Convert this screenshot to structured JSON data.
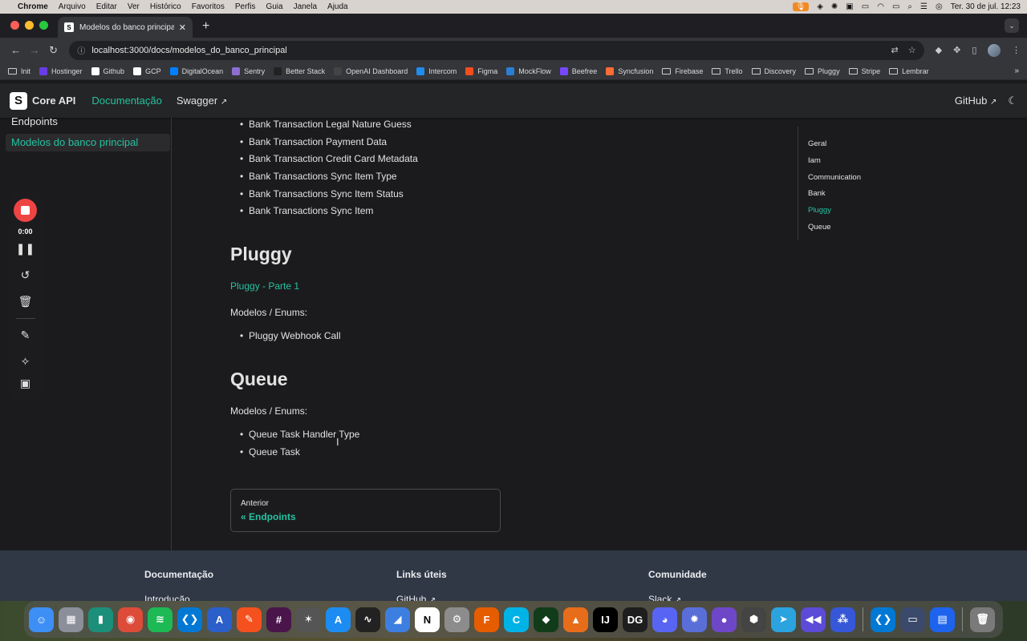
{
  "menubar": {
    "apple": "",
    "items": [
      "Chrome",
      "Arquivo",
      "Editar",
      "Ver",
      "Histórico",
      "Favoritos",
      "Perfis",
      "Guia",
      "Janela",
      "Ajuda"
    ],
    "datetime": "Ter. 30 de jul.  12:23"
  },
  "browser": {
    "tab_title": "Modelos do banco principal |",
    "url": "localhost:3000/docs/modelos_do_banco_principal",
    "bookmarks": [
      {
        "label": "Init",
        "kind": "folder"
      },
      {
        "label": "Hostinger",
        "color": "#673de6"
      },
      {
        "label": "Github",
        "color": "#ffffff"
      },
      {
        "label": "GCP",
        "color": "#ffffff"
      },
      {
        "label": "DigitalOcean",
        "color": "#0080ff"
      },
      {
        "label": "Sentry",
        "color": "#8d6fd1"
      },
      {
        "label": "Better Stack",
        "color": "#222222"
      },
      {
        "label": "OpenAI Dashboard",
        "color": "#444444"
      },
      {
        "label": "Intercom",
        "color": "#1f8ded"
      },
      {
        "label": "Figma",
        "color": "#f24e1e"
      },
      {
        "label": "MockFlow",
        "color": "#2a7fd4"
      },
      {
        "label": "Beefree",
        "color": "#7747ff"
      },
      {
        "label": "Syncfusion",
        "color": "#ff6c37"
      },
      {
        "label": "Firebase",
        "kind": "folder"
      },
      {
        "label": "Trello",
        "kind": "folder"
      },
      {
        "label": "Discovery",
        "kind": "folder"
      },
      {
        "label": "Pluggy",
        "kind": "folder"
      },
      {
        "label": "Stripe",
        "kind": "folder"
      },
      {
        "label": "Lembrar",
        "kind": "folder"
      }
    ]
  },
  "docnav": {
    "brand": "Core API",
    "links": [
      "Documentação",
      "Swagger"
    ],
    "github": "GitHub"
  },
  "sidebar": {
    "items": [
      {
        "label": "Endpoints",
        "active": false
      },
      {
        "label": "Modelos do banco principal",
        "active": true
      }
    ]
  },
  "recorder": {
    "timer": "0:00"
  },
  "content": {
    "bank_items": [
      "Bank Transaction Legal Nature Guess",
      "Bank Transaction Payment Data",
      "Bank Transaction Credit Card Metadata",
      "Bank Transactions Sync Item Type",
      "Bank Transactions Sync Item Status",
      "Bank Transactions Sync Item"
    ],
    "pluggy_heading": "Pluggy",
    "pluggy_link": "Pluggy - Parte 1",
    "pluggy_models_label": "Modelos / Enums:",
    "pluggy_items": [
      "Pluggy Webhook Call"
    ],
    "queue_heading": "Queue",
    "queue_models_label": "Modelos / Enums:",
    "queue_items": [
      "Queue Task Handler Type",
      "Queue Task"
    ],
    "pager_sub": "Anterior",
    "pager_label": "« Endpoints"
  },
  "toc": {
    "items": [
      "Geral",
      "Iam",
      "Communication",
      "Bank",
      "Pluggy",
      "Queue"
    ],
    "active": "Pluggy"
  },
  "footer": {
    "columns": [
      {
        "title": "Documentação",
        "link": "Introdução"
      },
      {
        "title": "Links úteis",
        "link": "GitHub"
      },
      {
        "title": "Comunidade",
        "link": "Slack"
      }
    ]
  },
  "dock": {
    "apps": [
      {
        "name": "finder",
        "color": "#3d8ef5",
        "glyph": "☺"
      },
      {
        "name": "launchpad",
        "color": "#8a8f99",
        "glyph": "▦"
      },
      {
        "name": "app-3",
        "color": "#1b8f7a",
        "glyph": "▮"
      },
      {
        "name": "chrome",
        "color": "#dd4b39",
        "glyph": "◉"
      },
      {
        "name": "spotify",
        "color": "#1db954",
        "glyph": "≋"
      },
      {
        "name": "vscode",
        "color": "#0078d4",
        "glyph": "❮❯"
      },
      {
        "name": "app-7",
        "color": "#2b5fc9",
        "glyph": "A"
      },
      {
        "name": "app-8",
        "color": "#f4511e",
        "glyph": "✎"
      },
      {
        "name": "slack",
        "color": "#4a154b",
        "glyph": "#"
      },
      {
        "name": "app-10",
        "color": "#555555",
        "glyph": "✶"
      },
      {
        "name": "app-store",
        "color": "#1c8cf3",
        "glyph": "A"
      },
      {
        "name": "activity-monitor",
        "color": "#222222",
        "glyph": "∿"
      },
      {
        "name": "app-13",
        "color": "#3d7fe0",
        "glyph": "◢"
      },
      {
        "name": "notion",
        "color": "#ffffff",
        "glyph": "N"
      },
      {
        "name": "system-settings",
        "color": "#8c8c8c",
        "glyph": "⚙"
      },
      {
        "name": "app-16",
        "color": "#e65c00",
        "glyph": "F"
      },
      {
        "name": "app-17",
        "color": "#00b3e6",
        "glyph": "C"
      },
      {
        "name": "mongodb",
        "color": "#113c1a",
        "glyph": "◆"
      },
      {
        "name": "matlab",
        "color": "#e76d1a",
        "glyph": "▲"
      },
      {
        "name": "intellij",
        "color": "#000000",
        "glyph": "IJ"
      },
      {
        "name": "datagrip",
        "color": "#1e1e1e",
        "glyph": "DG"
      },
      {
        "name": "discord",
        "color": "#5865f2",
        "glyph": "◕"
      },
      {
        "name": "app-23",
        "color": "#5a6ed8",
        "glyph": "✹"
      },
      {
        "name": "app-24",
        "color": "#6e47c8",
        "glyph": "●"
      },
      {
        "name": "app-25",
        "color": "#444444",
        "glyph": "⬢"
      },
      {
        "name": "telegram",
        "color": "#2aa3df",
        "glyph": "➤"
      },
      {
        "name": "app-27",
        "color": "#5b4bd6",
        "glyph": "◀◀"
      },
      {
        "name": "app-28",
        "color": "#3657d8",
        "glyph": "⁂"
      },
      {
        "name": "vscode-2",
        "color": "#0078d4",
        "glyph": "❮❯"
      },
      {
        "name": "app-30",
        "color": "#3b4a6b",
        "glyph": "▭"
      },
      {
        "name": "docker",
        "color": "#1d63ed",
        "glyph": "▤"
      },
      {
        "name": "trash",
        "color": "#7a7a7a",
        "glyph": "🗑"
      }
    ]
  },
  "colors": {
    "accent": "#25c2a0",
    "record": "#ee4444"
  }
}
